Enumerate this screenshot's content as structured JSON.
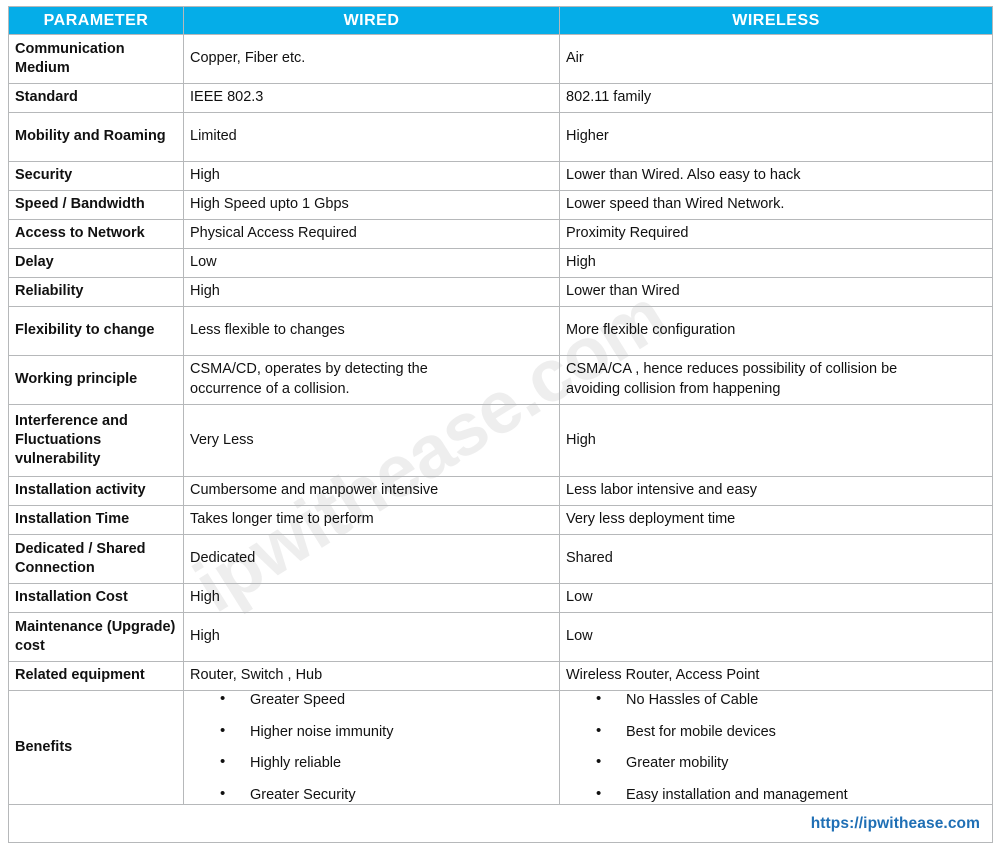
{
  "watermark": {
    "text": "ipwithease.com"
  },
  "table": {
    "headers": {
      "parameter": "PARAMETER",
      "wired": "WIRED",
      "wireless": "WIRELESS"
    },
    "header_bg": "#05ADE8",
    "header_text_color": "#FFFFFF",
    "border_color": "#B6B8BA",
    "rows": [
      {
        "parameter_line1": "Communication",
        "parameter_line2": "Medium",
        "wired": "Copper, Fiber etc.",
        "wireless": "Air"
      },
      {
        "parameter_line1": "Standard",
        "parameter_line2": "",
        "wired": "IEEE 802.3",
        "wireless": "802.11 family"
      },
      {
        "parameter_line1": "Mobility and",
        "parameter_line2": "Roaming",
        "wired": "Limited",
        "wireless": "Higher"
      },
      {
        "parameter_line1": "Security",
        "parameter_line2": "",
        "wired": "High",
        "wireless": "Lower than Wired. Also easy to hack"
      },
      {
        "parameter_line1": "Speed / Bandwidth",
        "parameter_line2": "",
        "wired": "High Speed upto 1 Gbps",
        "wireless": "Lower speed than Wired Network."
      },
      {
        "parameter_line1": "Access to Network",
        "parameter_line2": "",
        "wired": "Physical Access Required",
        "wireless": "Proximity Required"
      },
      {
        "parameter_line1": "Delay",
        "parameter_line2": "",
        "wired": "Low",
        "wireless": "High"
      },
      {
        "parameter_line1": "Reliability",
        "parameter_line2": "",
        "wired": "High",
        "wireless": "Lower than Wired"
      },
      {
        "parameter_line1": "Flexibility to",
        "parameter_line2": "change",
        "wired": "Less flexible to changes",
        "wireless": "More flexible configuration"
      },
      {
        "parameter_line1": "Working principle",
        "parameter_line2": "",
        "wired_line1": "CSMA/CD, operates by detecting the",
        "wired_line2": "occurrence of a collision.",
        "wireless_line1": "CSMA/CA , hence reduces possibility of collision be",
        "wireless_line2": "avoiding collision from happening"
      },
      {
        "parameter_line1": "Interference and",
        "parameter_line2": "Fluctuations",
        "parameter_line3": "vulnerability",
        "wired": "Very Less",
        "wireless": "High"
      },
      {
        "parameter_line1": "Installation activity",
        "parameter_line2": "",
        "wired": "Cumbersome and manpower intensive",
        "wireless": "Less labor intensive and easy"
      },
      {
        "parameter_line1": "Installation Time",
        "parameter_line2": "",
        "wired": "Takes longer time to perform",
        "wireless": "Very less deployment time"
      },
      {
        "parameter_line1": "Dedicated / Shared",
        "parameter_line2": "Connection",
        "wired": "Dedicated",
        "wireless": "Shared"
      },
      {
        "parameter_line1": "Installation Cost",
        "parameter_line2": "",
        "wired": "High",
        "wireless": "Low"
      },
      {
        "parameter_line1": "Maintenance",
        "parameter_line2": "(Upgrade) cost",
        "wired": "High",
        "wireless": "Low"
      },
      {
        "parameter_line1": "Related equipment",
        "parameter_line2": "",
        "wired": "Router, Switch , Hub",
        "wireless": "Wireless Router, Access Point"
      }
    ],
    "benefits_row": {
      "parameter": "Benefits",
      "wired_items": [
        "Greater Speed",
        "Higher noise immunity",
        "Highly reliable",
        "Greater Security"
      ],
      "wireless_items": [
        "No Hassles of Cable",
        "Best for mobile devices",
        "Greater mobility",
        "Easy installation and management"
      ]
    },
    "footer": {
      "url": "https://ipwithease.com",
      "url_color": "#1F6FB5"
    }
  }
}
